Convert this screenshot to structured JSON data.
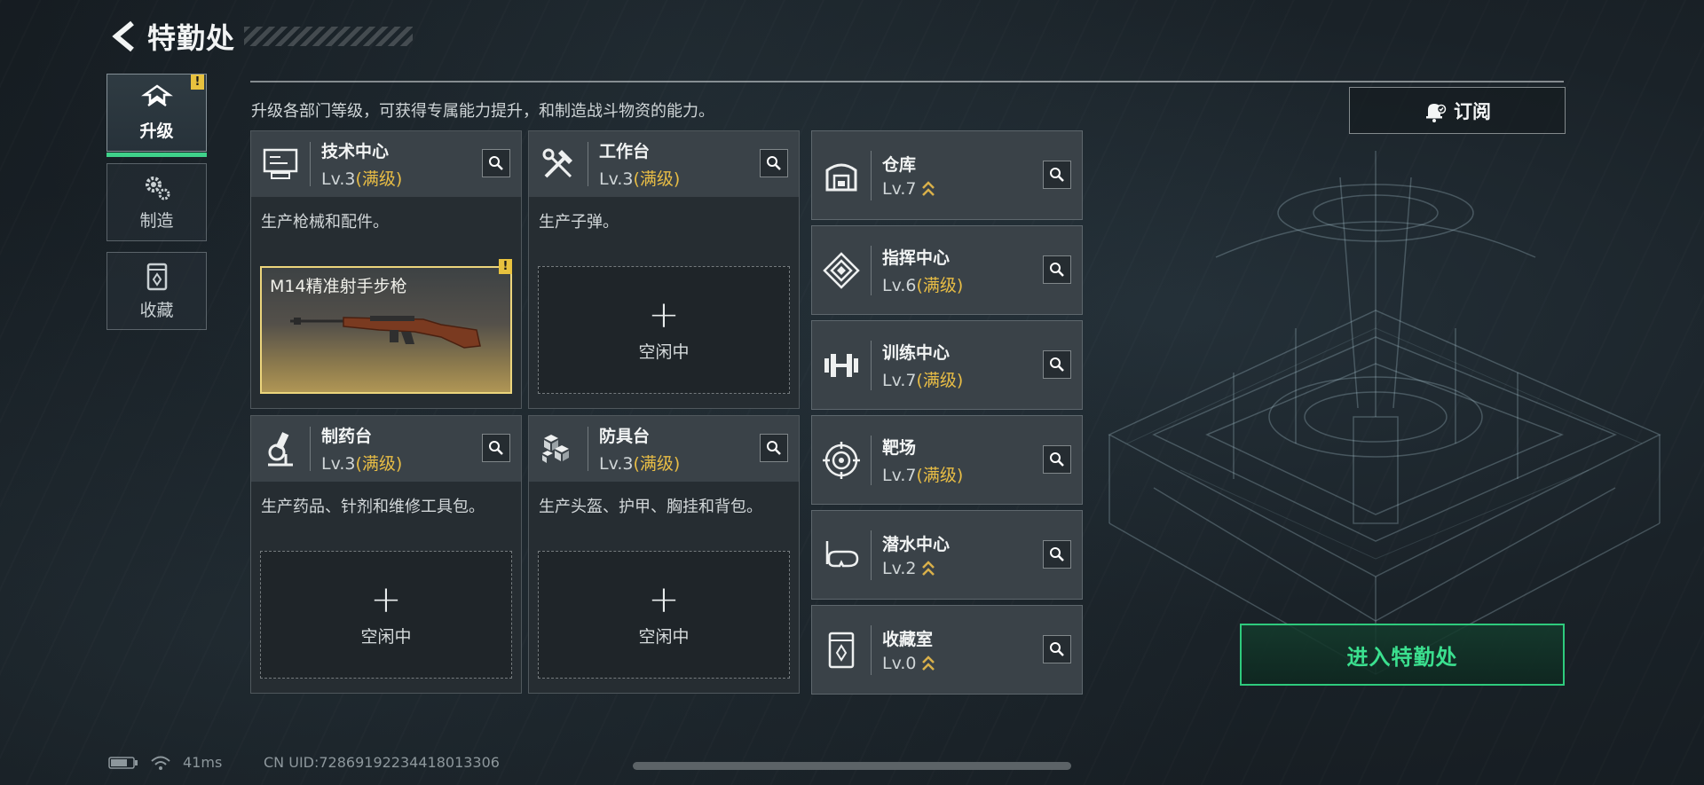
{
  "header": {
    "title": "特勤处"
  },
  "tabs": [
    {
      "label": "升级",
      "active": true,
      "has_alert": true,
      "alert": "!"
    },
    {
      "label": "制造",
      "active": false
    },
    {
      "label": "收藏",
      "active": false
    }
  ],
  "description": "升级各部门等级，可获得专属能力提升，和制造战斗物资的能力。",
  "subscribe_label": "订阅",
  "cards": [
    {
      "name": "技术中心",
      "level": "Lv.3",
      "status": "(满级)",
      "desc": "生产枪械和配件。",
      "slot_item": "M14精准射手步枪",
      "slot_alert": "!"
    },
    {
      "name": "工作台",
      "level": "Lv.3",
      "status": "(满级)",
      "desc": "生产子弹。",
      "slot_plus": "+",
      "slot_state": "空闲中"
    },
    {
      "name": "制药台",
      "level": "Lv.3",
      "status": "(满级)",
      "desc": "生产药品、针剂和维修工具包。",
      "slot_plus": "+",
      "slot_state": "空闲中"
    },
    {
      "name": "防具台",
      "level": "Lv.3",
      "status": "(满级)",
      "desc": "生产头盔、护甲、胸挂和背包。",
      "slot_plus": "+",
      "slot_state": "空闲中"
    }
  ],
  "small_cards": [
    {
      "name": "仓库",
      "level": "Lv.7",
      "status": "",
      "upgradable": true
    },
    {
      "name": "指挥中心",
      "level": "Lv.6",
      "status": "(满级)",
      "upgradable": false
    },
    {
      "name": "训练中心",
      "level": "Lv.7",
      "status": "(满级)",
      "upgradable": false
    },
    {
      "name": "靶场",
      "level": "Lv.7",
      "status": "(满级)",
      "upgradable": false
    },
    {
      "name": "潜水中心",
      "level": "Lv.2",
      "status": "",
      "upgradable": true
    },
    {
      "name": "收藏室",
      "level": "Lv.0",
      "status": "",
      "upgradable": true
    }
  ],
  "enter_label": "进入特勤处",
  "status_bar": {
    "ping": "41ms",
    "uid": "CN UID:72869192234418013306"
  },
  "colors": {
    "accent_green": "#3be08f",
    "max_level_gold": "#e8bd45",
    "alert_yellow": "#e8c23e"
  }
}
